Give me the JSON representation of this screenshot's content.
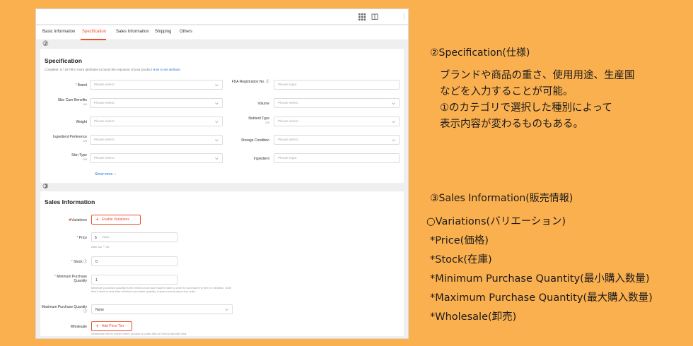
{
  "tabs": [
    "Basic Information",
    "Specification",
    "Sales Information",
    "Shipping",
    "Others"
  ],
  "specification": {
    "marker": "②",
    "title": "Specification",
    "complete_prefix": "Complete: 0 / 19",
    "complete_text": " Fill in more attributes to boost the exposure of your product ",
    "complete_link": "How to set attribute",
    "fields_left": [
      {
        "label": "Brand",
        "required": true,
        "count": "",
        "placeholder": "Please select"
      },
      {
        "label": "Skin Care Benefits",
        "required": false,
        "count": "0/5",
        "placeholder": "Please select"
      },
      {
        "label": "Weight",
        "required": false,
        "count": "",
        "placeholder": "Please select"
      },
      {
        "label": "Ingredient Preference",
        "required": false,
        "count": "0/5",
        "placeholder": "Please select"
      },
      {
        "label": "Skin Type",
        "required": false,
        "count": "0/5",
        "placeholder": "Please select"
      }
    ],
    "fields_right": [
      {
        "label": "FDA Registration No.",
        "placeholder": "Please input"
      },
      {
        "label": "Volume",
        "placeholder": "Please select"
      },
      {
        "label": "Nutrient Type",
        "count": "0/5",
        "placeholder": "Please select"
      },
      {
        "label": "Storage Condition",
        "placeholder": "Please select"
      },
      {
        "label": "Ingredient",
        "placeholder": "Please input"
      }
    ],
    "show_more": "Show more ⌵"
  },
  "sales": {
    "marker": "③",
    "title": "Sales Information",
    "variations_label": "Variations",
    "enable_variations": "Enable Variations",
    "price_label": "Price",
    "price_currency": "$",
    "price_placeholder": "Input",
    "after_tax": "After tax ⓘ  $0",
    "stock_label": "Stock ⓘ",
    "stock_value": "0",
    "min_label": "Minimum Purchase Quantity",
    "min_value": "1",
    "min_hint": "Minimum purchase quantity is the minimum amount buyers have to order to purchase the item or variation. Note that if stock is less than minimum purchase quantity, buyers cannot place any order.",
    "max_label": "Maximum Purchase Quantity ⓘ",
    "max_value": "None",
    "wholesale_label": "Wholesale",
    "add_price_tier": "Add Price Tier",
    "wholesale_hint": "Wholesale will be hidden when product is under Add-on Deal & Bundle Deal."
  },
  "notes": {
    "spec_heading": "②Specification(仕様)",
    "spec_lines": [
      "ブランドや商品の重さ、使用用途、生産国",
      "などを入力することが可能。",
      "①のカテゴリで選択した種別によって",
      "表示内容が変わるものもある。"
    ],
    "sales_heading": "③Sales Information(販売情報)",
    "sales_lines": [
      "○Variations(バリエーション)",
      " *Price(価格)",
      " *Stock(在庫)",
      " *Minimum Purchase Quantity(最小購入数量)",
      " *Maximum Purchase Quantity(最大購入数量)",
      " *Wholesale(卸売)"
    ]
  },
  "colors": {
    "background": "#fbb04f",
    "accent": "#ee4d2d",
    "link": "#2673dd"
  }
}
